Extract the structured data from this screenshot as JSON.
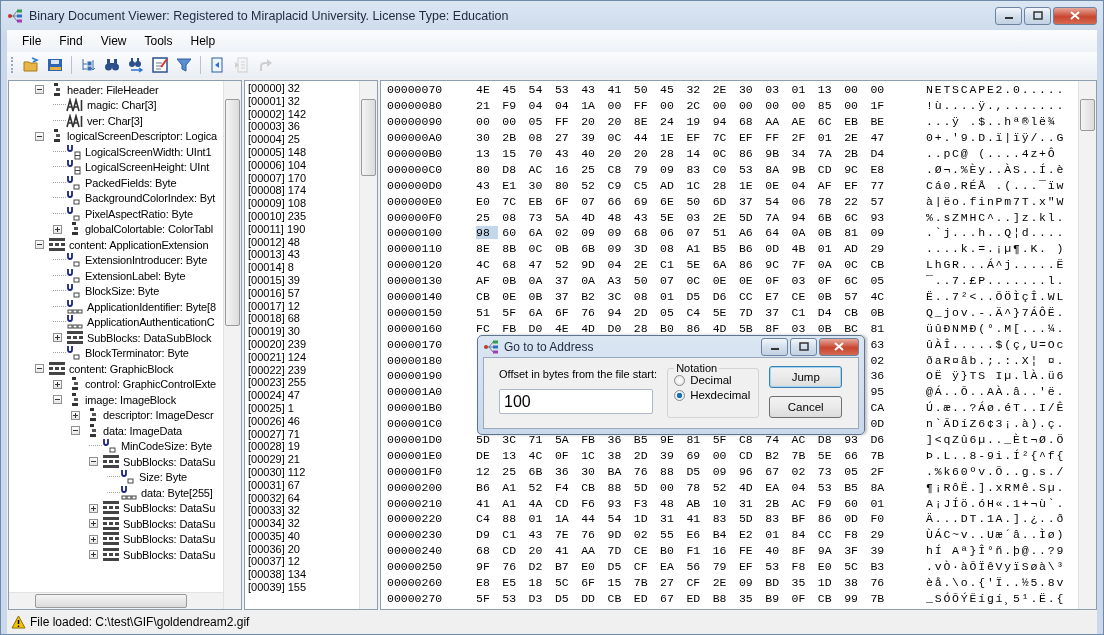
{
  "window": {
    "title": "Binary Document Viewer: Registered to Miraplacid University. License Type: Education"
  },
  "menu": [
    "File",
    "Find",
    "View",
    "Tools",
    "Help"
  ],
  "toolbar": [
    {
      "kind": "open",
      "disabled": false
    },
    {
      "kind": "save",
      "disabled": false
    },
    {
      "kind": "sep"
    },
    {
      "kind": "tree",
      "disabled": false
    },
    {
      "kind": "find",
      "disabled": false
    },
    {
      "kind": "find-next",
      "disabled": false
    },
    {
      "kind": "edit",
      "disabled": false
    },
    {
      "kind": "filter",
      "disabled": false
    },
    {
      "kind": "sep"
    },
    {
      "kind": "back",
      "disabled": false
    },
    {
      "kind": "forward",
      "disabled": true
    },
    {
      "kind": "arrow",
      "disabled": true
    }
  ],
  "tree": [
    {
      "label": "header: FileHeader",
      "kind": "struct",
      "expanded": true,
      "children": [
        {
          "label": "magic: Char[3]",
          "kind": "chars"
        },
        {
          "label": "ver: Char[3]",
          "kind": "chars"
        }
      ]
    },
    {
      "label": "logicalScreenDescriptor: Logica",
      "kind": "struct",
      "expanded": true,
      "children": [
        {
          "label": "LogicalScreenWidth: UInt1",
          "kind": "word"
        },
        {
          "label": "LogicalScreenHeight: UInt",
          "kind": "word"
        },
        {
          "label": "PackedFields: Byte",
          "kind": "byte"
        },
        {
          "label": "BackgroundColorIndex: Byt",
          "kind": "byte"
        },
        {
          "label": "PixelAspectRatio: Byte",
          "kind": "byte"
        },
        {
          "label": "globalColortable: ColorTabl",
          "kind": "struct",
          "expanded": false
        }
      ]
    },
    {
      "label": "content: ApplicationExtension",
      "kind": "list",
      "expanded": true,
      "children": [
        {
          "label": "ExtensionIntroducer: Byte",
          "kind": "byte"
        },
        {
          "label": "ExtensionLabel: Byte",
          "kind": "byte"
        },
        {
          "label": "BlockSize: Byte",
          "kind": "byte"
        },
        {
          "label": "ApplicationIdentifier: Byte[8",
          "kind": "array"
        },
        {
          "label": "ApplicationAuthenticationC",
          "kind": "array"
        },
        {
          "label": "SubBlocks: DataSubBlock",
          "kind": "list",
          "expanded": false
        },
        {
          "label": "BlockTerminator: Byte",
          "kind": "byte"
        }
      ]
    },
    {
      "label": "content: GraphicBlock",
      "kind": "list",
      "expanded": true,
      "children": [
        {
          "label": "control: GraphicControlExte",
          "kind": "struct",
          "expanded": false
        },
        {
          "label": "image: ImageBlock",
          "kind": "struct",
          "expanded": true,
          "children": [
            {
              "label": "descriptor: ImageDescr",
              "kind": "struct",
              "expanded": false
            },
            {
              "label": "data: ImageData",
              "kind": "struct",
              "expanded": true,
              "children": [
                {
                  "label": "MinCodeSize: Byte",
                  "kind": "byte"
                },
                {
                  "label": "SubBlocks: DataSu",
                  "kind": "list",
                  "expanded": true,
                  "children": [
                    {
                      "label": "Size: Byte",
                      "kind": "byte"
                    },
                    {
                      "label": "data: Byte[255]",
                      "kind": "array"
                    }
                  ]
                },
                {
                  "label": "SubBlocks: DataSu",
                  "kind": "list",
                  "expanded": false
                },
                {
                  "label": "SubBlocks: DataSu",
                  "kind": "list",
                  "expanded": false
                },
                {
                  "label": "SubBlocks: DataSu",
                  "kind": "list",
                  "expanded": false
                },
                {
                  "label": "SubBlocks: DataSu",
                  "kind": "list",
                  "expanded": false
                }
              ]
            }
          ]
        }
      ]
    }
  ],
  "index_list": [
    "[00000] 32",
    "[00001] 32",
    "[00002] 142",
    "[00003] 36",
    "[00004] 25",
    "[00005] 148",
    "[00006] 104",
    "[00007] 170",
    "[00008] 174",
    "[00009] 108",
    "[00010] 235",
    "[00011] 190",
    "[00012] 48",
    "[00013] 43",
    "[00014] 8",
    "[00015] 39",
    "[00016] 57",
    "[00017] 12",
    "[00018] 68",
    "[00019] 30",
    "[00020] 239",
    "[00021] 124",
    "[00022] 239",
    "[00023] 255",
    "[00024] 47",
    "[00025] 1",
    "[00026] 46",
    "[00027] 71",
    "[00028] 19",
    "[00029] 21",
    "[00030] 112",
    "[00031] 67",
    "[00032] 64",
    "[00033] 32",
    "[00034] 32",
    "[00035] 40",
    "[00036] 20",
    "[00037] 12",
    "[00038] 134",
    "[00039] 155"
  ],
  "hex_rows": [
    {
      "address": "00000070",
      "bytes": [
        "4E",
        "45",
        "54",
        "53",
        "43",
        "41",
        "50",
        "45",
        "32",
        "2E",
        "30",
        "03",
        "01",
        "13",
        "00",
        "00"
      ],
      "ascii": "NETSCAPE2.0.....",
      "selected": false
    },
    {
      "address": "00000080",
      "bytes": [
        "21",
        "F9",
        "04",
        "04",
        "1A",
        "00",
        "FF",
        "00",
        "2C",
        "00",
        "00",
        "00",
        "00",
        "85",
        "00",
        "1F"
      ],
      "ascii": "!ù....ÿ.,.......",
      "selected": false
    },
    {
      "address": "00000090",
      "bytes": [
        "00",
        "00",
        "05",
        "FF",
        "20",
        "20",
        "8E",
        "24",
        "19",
        "94",
        "68",
        "AA",
        "AE",
        "6C",
        "EB",
        "BE"
      ],
      "ascii": "...ÿ  .$..hª®lë¾",
      "selected": false
    },
    {
      "address": "000000A0",
      "bytes": [
        "30",
        "2B",
        "08",
        "27",
        "39",
        "0C",
        "44",
        "1E",
        "EF",
        "7C",
        "EF",
        "FF",
        "2F",
        "01",
        "2E",
        "47"
      ],
      "ascii": "0+.'9.D.ï|ïÿ/..G",
      "selected": false
    },
    {
      "address": "000000B0",
      "bytes": [
        "13",
        "15",
        "70",
        "43",
        "40",
        "20",
        "20",
        "28",
        "14",
        "0C",
        "86",
        "9B",
        "34",
        "7A",
        "2B",
        "D4"
      ],
      "ascii": "..pC@  (....4z+Ô",
      "selected": false
    },
    {
      "address": "000000C0",
      "bytes": [
        "80",
        "D8",
        "AC",
        "16",
        "25",
        "C8",
        "79",
        "09",
        "83",
        "C0",
        "53",
        "8A",
        "9B",
        "CD",
        "9C",
        "E8"
      ],
      "ascii": ".Ø¬.%Èy..ÀS..Í.è",
      "selected": false
    },
    {
      "address": "000000D0",
      "bytes": [
        "43",
        "E1",
        "30",
        "80",
        "52",
        "C9",
        "C5",
        "AD",
        "1C",
        "28",
        "1E",
        "0E",
        "04",
        "AF",
        "EF",
        "77"
      ],
      "ascii": "Cá0.RÉÅ .(...¯ïw",
      "selected": false
    },
    {
      "address": "000000E0",
      "bytes": [
        "E0",
        "7C",
        "EB",
        "6F",
        "07",
        "66",
        "69",
        "6E",
        "50",
        "6D",
        "37",
        "54",
        "06",
        "78",
        "22",
        "57"
      ],
      "ascii": "à|ëo.finPm7T.x\"W",
      "selected": false
    },
    {
      "address": "000000F0",
      "bytes": [
        "25",
        "08",
        "73",
        "5A",
        "4D",
        "48",
        "43",
        "5E",
        "03",
        "2E",
        "5D",
        "7A",
        "94",
        "6B",
        "6C",
        "93"
      ],
      "ascii": "%.sZMHC^..]z.kl.",
      "selected": false
    },
    {
      "address": "00000100",
      "bytes": [
        "98",
        "60",
        "6A",
        "02",
        "09",
        "09",
        "68",
        "06",
        "07",
        "51",
        "A6",
        "64",
        "0A",
        "0B",
        "81",
        "09"
      ],
      "ascii": ".`j...h..Q¦d....",
      "selected": true
    },
    {
      "address": "00000110",
      "bytes": [
        "8E",
        "8B",
        "0C",
        "0B",
        "6B",
        "09",
        "3D",
        "08",
        "A1",
        "B5",
        "B6",
        "0D",
        "4B",
        "01",
        "AD",
        "29"
      ],
      "ascii": "....k.=.¡µ¶.K. )",
      "selected": false
    },
    {
      "address": "00000120",
      "bytes": [
        "4C",
        "68",
        "47",
        "52",
        "9D",
        "04",
        "2E",
        "C1",
        "5E",
        "6A",
        "86",
        "9C",
        "7F",
        "0A",
        "0C",
        "CB"
      ],
      "ascii": "LhGR...Á^j.....Ë",
      "selected": false
    },
    {
      "address": "00000130",
      "bytes": [
        "AF",
        "0B",
        "0A",
        "37",
        "0A",
        "A3",
        "50",
        "07",
        "0C",
        "0E",
        "0E",
        "0F",
        "03",
        "0F",
        "6C",
        "05"
      ],
      "ascii": "¯..7.£P.......l.",
      "selected": false
    },
    {
      "address": "00000140",
      "bytes": [
        "CB",
        "0E",
        "0B",
        "37",
        "B2",
        "3C",
        "08",
        "01",
        "D5",
        "D6",
        "CC",
        "E7",
        "CE",
        "0B",
        "57",
        "4C"
      ],
      "ascii": "Ë..7²<..ÕÖÌçÎ.WL",
      "selected": false
    },
    {
      "address": "00000150",
      "bytes": [
        "51",
        "5F",
        "6A",
        "6F",
        "76",
        "94",
        "2D",
        "05",
        "C4",
        "5E",
        "7D",
        "37",
        "C1",
        "D4",
        "CB",
        "0B"
      ],
      "ascii": "Q_jov.-.Ä^}7ÁÔË.",
      "selected": false
    },
    {
      "address": "00000160",
      "bytes": [
        "FC",
        "FB",
        "D0",
        "4E",
        "4D",
        "D0",
        "28",
        "B0",
        "86",
        "4D",
        "5B",
        "8F",
        "03",
        "0B",
        "BC",
        "81"
      ],
      "ascii": "üûÐNMÐ(°.M[...¼.",
      "selected": false
    },
    {
      "address": "00000170",
      "bytes": [
        "63"
      ],
      "ascii": "ûÀÎ.....$(ç,U=Oc",
      "selected": false
    },
    {
      "address": "00000180",
      "bytes": [
        "02"
      ],
      "ascii": "ðaR¤âb.;.:.X¦ ¤.",
      "selected": false
    },
    {
      "address": "00000190",
      "bytes": [
        "36"
      ],
      "ascii": "OË ÿ}TS Iµ.lÀ.ü6",
      "selected": false
    },
    {
      "address": "000001A0",
      "bytes": [
        "95"
      ],
      "ascii": "@Á..Õ..AÀ.â..'ë.",
      "selected": false
    },
    {
      "address": "000001B0",
      "bytes": [
        "CA"
      ],
      "ascii": "Ú.æ..?Áø.éT..I/Ê",
      "selected": false
    },
    {
      "address": "000001C0",
      "bytes": [
        "0D"
      ],
      "ascii": "n`ÃDíZ6¢3¡.à).ç.",
      "selected": false
    },
    {
      "address": "000001D0",
      "bytes": [
        "5D",
        "3C",
        "71",
        "5A",
        "FB",
        "36",
        "B5",
        "9E",
        "81",
        "5F",
        "C8",
        "74",
        "AC",
        "D8",
        "93",
        "D6"
      ],
      "ascii": "]<qZû6µ.._Èt¬Ø.Ö",
      "selected": false
    },
    {
      "address": "000001E0",
      "bytes": [
        "DE",
        "13",
        "4C",
        "0F",
        "1C",
        "38",
        "2D",
        "39",
        "69",
        "00",
        "CD",
        "B2",
        "7B",
        "5E",
        "66",
        "7B"
      ],
      "ascii": "Þ.L..8-9i.Í²{^f{",
      "selected": false
    },
    {
      "address": "000001F0",
      "bytes": [
        "12",
        "25",
        "6B",
        "36",
        "30",
        "BA",
        "76",
        "88",
        "D5",
        "09",
        "96",
        "67",
        "02",
        "73",
        "05",
        "2F"
      ],
      "ascii": ".%k60ºv.Õ..g.s./",
      "selected": false
    },
    {
      "address": "00000200",
      "bytes": [
        "B6",
        "A1",
        "52",
        "F4",
        "CB",
        "88",
        "5D",
        "00",
        "78",
        "52",
        "4D",
        "EA",
        "04",
        "53",
        "B5",
        "8A"
      ],
      "ascii": "¶¡RôË.].xRMê.Sµ.",
      "selected": false
    },
    {
      "address": "00000210",
      "bytes": [
        "41",
        "A1",
        "4A",
        "CD",
        "F6",
        "93",
        "F3",
        "48",
        "AB",
        "10",
        "31",
        "2B",
        "AC",
        "F9",
        "60",
        "01"
      ],
      "ascii": "A¡JÍö.óH«.1+¬ù`.",
      "selected": false
    },
    {
      "address": "00000220",
      "bytes": [
        "C4",
        "88",
        "01",
        "1A",
        "44",
        "54",
        "1D",
        "31",
        "41",
        "83",
        "5D",
        "83",
        "BF",
        "86",
        "0D",
        "F0"
      ],
      "ascii": "Ä...DT.1A.].¿..ð",
      "selected": false
    },
    {
      "address": "00000230",
      "bytes": [
        "D9",
        "C1",
        "43",
        "7E",
        "76",
        "9D",
        "02",
        "55",
        "E6",
        "B4",
        "E2",
        "01",
        "84",
        "CC",
        "F8",
        "29"
      ],
      "ascii": "ÙÁC~v..Uæ´â..Ìø)",
      "selected": false
    },
    {
      "address": "00000240",
      "bytes": [
        "68",
        "CD",
        "20",
        "41",
        "AA",
        "7D",
        "CE",
        "B0",
        "F1",
        "16",
        "FE",
        "40",
        "8F",
        "9A",
        "3F",
        "39"
      ],
      "ascii": "hÍ Aª}Î°ñ.þ@..?9",
      "selected": false
    },
    {
      "address": "00000250",
      "bytes": [
        "9F",
        "76",
        "D2",
        "B7",
        "E0",
        "D5",
        "CF",
        "EA",
        "56",
        "79",
        "EF",
        "53",
        "F8",
        "E0",
        "5C",
        "B3"
      ],
      "ascii": ".vÒ·àÕÏêVyïSøà\\³",
      "selected": false
    },
    {
      "address": "00000260",
      "bytes": [
        "E8",
        "E5",
        "18",
        "5C",
        "6F",
        "15",
        "7B",
        "27",
        "CF",
        "2E",
        "09",
        "BD",
        "35",
        "1D",
        "38",
        "76"
      ],
      "ascii": "èå.\\o.{'Ï..½5.8v",
      "selected": false
    },
    {
      "address": "00000270",
      "bytes": [
        "5F",
        "53",
        "D3",
        "D5",
        "DD",
        "CB",
        "ED",
        "67",
        "ED",
        "B8",
        "35",
        "B9",
        "0F",
        "CB",
        "99",
        "7B"
      ],
      "ascii": "_SÓÕÝËígí¸5¹.Ë.{",
      "selected": false
    }
  ],
  "dialog": {
    "title": "Go to to Address",
    "offset_label": "Offset in bytes from the file start:",
    "offset_value": "100",
    "notation": {
      "title": "Notation",
      "options": [
        {
          "label": "Decimal",
          "selected": false
        },
        {
          "label": "Hexdecimal",
          "selected": true
        }
      ]
    },
    "buttons": [
      {
        "label": "Jump",
        "default": true
      },
      {
        "label": "Cancel",
        "default": false
      }
    ]
  },
  "status_bar": {
    "text": "File loaded: C:\\test\\GIF\\goldendream2.gif"
  }
}
